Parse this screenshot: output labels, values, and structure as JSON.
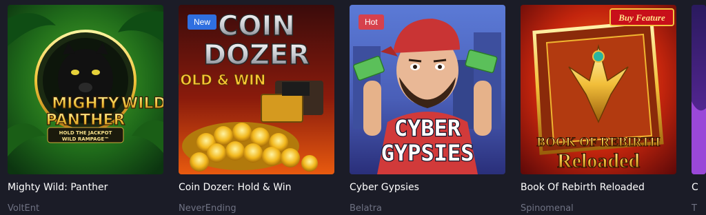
{
  "games": [
    {
      "title": "Mighty Wild: Panther",
      "provider": "VoltEnt",
      "badge": "",
      "art": {
        "line1": "MIGHTY",
        "line2": "WILD",
        "tm": "™",
        "line3": "PANTHER",
        "tagline1": "HOLD THE JACKPOT",
        "tagline2": "WILD RAMPAGE™"
      }
    },
    {
      "title": "Coin Dozer: Hold & Win",
      "provider": "NeverEnding",
      "badge": "New",
      "art": {
        "line1": "COIN",
        "line2": "DOZER",
        "line3": "HOLD & WIN"
      }
    },
    {
      "title": "Cyber Gypsies",
      "provider": "Belatra",
      "badge": "Hot",
      "art": {
        "line1": "CYBER",
        "line2": "GYPSIES"
      }
    },
    {
      "title": "Book Of Rebirth Reloaded",
      "provider": "Spinomenal",
      "badge": "",
      "art": {
        "ribbon": "Buy Feature",
        "line1": "BOOK OF REBIRTH",
        "line2": "Reloaded"
      }
    },
    {
      "title": "C",
      "provider": "T",
      "badge": "",
      "art": {}
    }
  ],
  "colors": {
    "background": "#1b1c27",
    "title": "#ffffff",
    "provider": "#6f7283",
    "badge_new": "#2f6fe0",
    "badge_hot": "#d6414c"
  },
  "icons": {
    "card1": "panther-art-icon",
    "card2": "coin-dozer-art-icon",
    "card3": "cyber-gypsy-art-icon",
    "card4": "book-of-rebirth-art-icon"
  }
}
